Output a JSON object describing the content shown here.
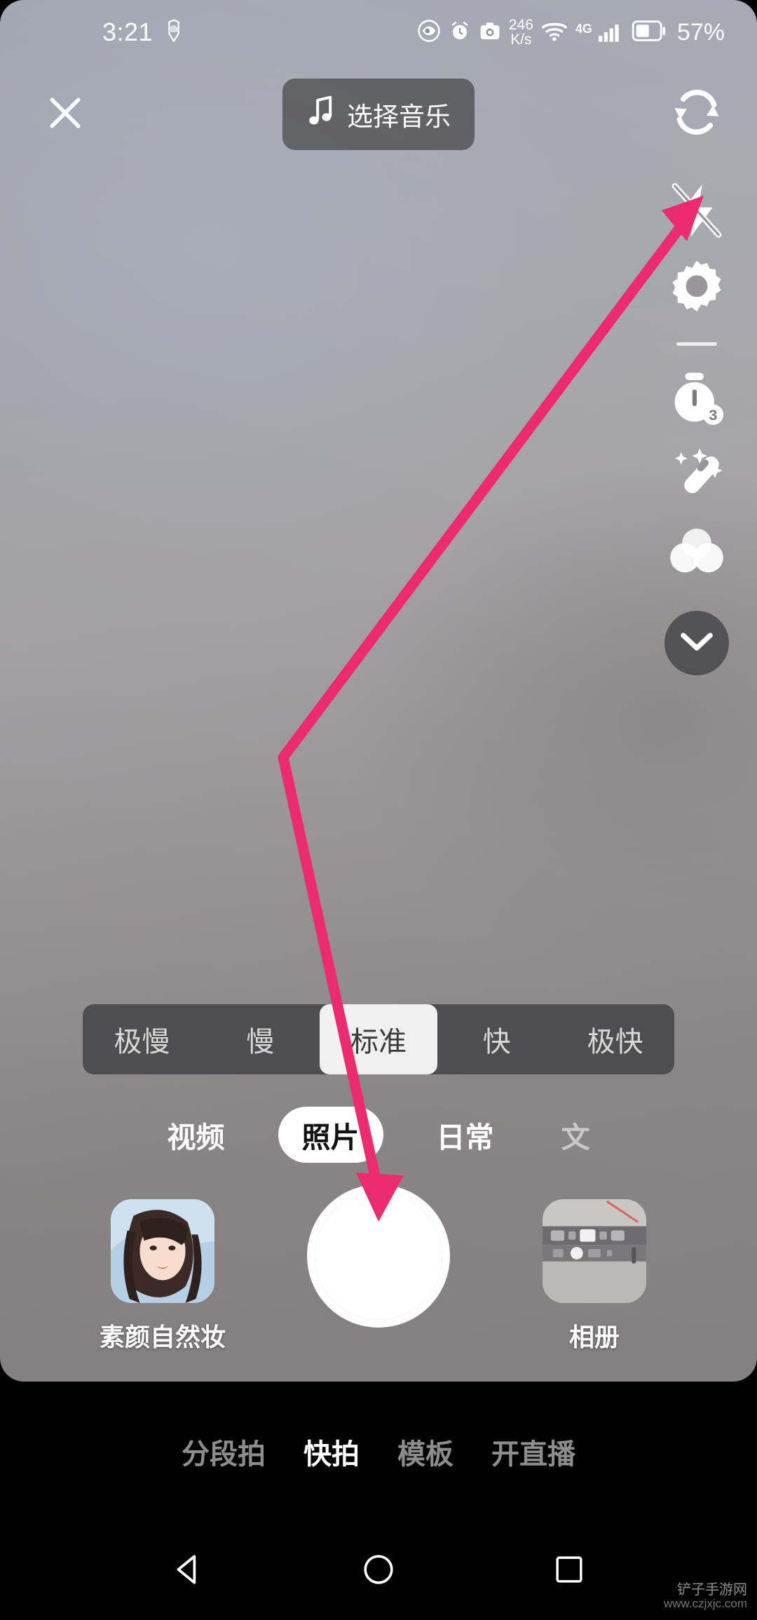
{
  "status_bar": {
    "time": "3:21",
    "net_speed_value": "246",
    "net_speed_unit": "K/s",
    "network_type": "4G",
    "battery_percent": "57%",
    "icons": [
      "hand-icon",
      "eye-icon",
      "alarm-icon",
      "camera-icon",
      "wifi-icon",
      "signal-icon",
      "battery-icon"
    ]
  },
  "top_bar": {
    "close_label": "close-icon",
    "music_label": "选择音乐",
    "music_icon": "music-note-icon",
    "flip_label": "flip-camera-icon"
  },
  "right_toolbar": {
    "items": [
      {
        "name": "flash-off-icon",
        "label": "闪光灯关闭"
      },
      {
        "name": "settings-gear-icon",
        "label": "设置"
      },
      {
        "name": "timer-icon",
        "label": "倒计时",
        "badge": "3"
      },
      {
        "name": "magic-wand-icon",
        "label": "美颜"
      },
      {
        "name": "filters-icon",
        "label": "滤镜"
      }
    ],
    "collapse_label": "chevron-down-icon"
  },
  "speed_bar": {
    "options": [
      "极慢",
      "慢",
      "标准",
      "快",
      "极快"
    ],
    "selected": "标准"
  },
  "mode_row": {
    "options": [
      "视频",
      "照片",
      "日常",
      "文"
    ],
    "selected": "照片"
  },
  "capture_row": {
    "beauty_label": "素颜自然妆",
    "shutter_label": "shutter-button",
    "album_label": "相册"
  },
  "bottom_nav": {
    "items": [
      "分段拍",
      "快拍",
      "模板",
      "开直播"
    ],
    "selected": "快拍"
  },
  "android_nav": {
    "back": "back-icon",
    "home": "home-icon",
    "recents": "recents-icon"
  },
  "annotation": {
    "color": "#ec2a6e",
    "description": "arrow pointing to flash-off icon"
  },
  "watermark": {
    "title": "铲子手游网",
    "url": "www.czjxjc.com"
  }
}
